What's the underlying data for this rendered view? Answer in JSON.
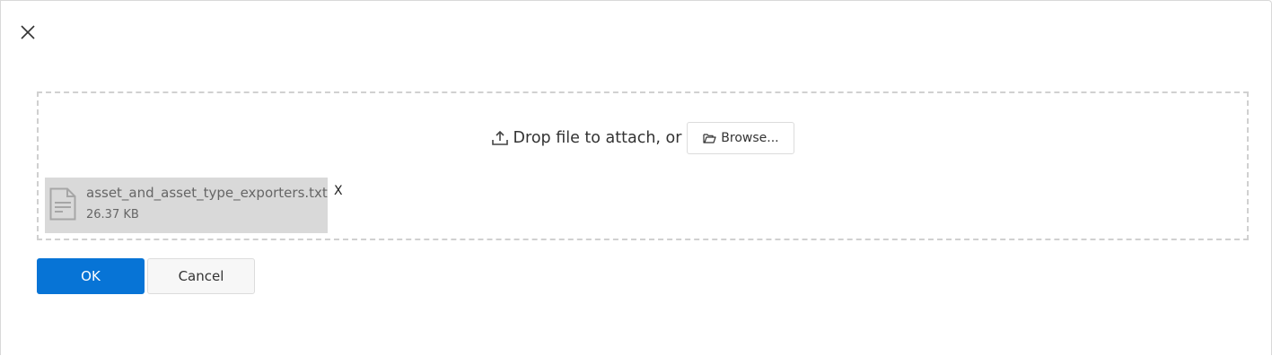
{
  "dialog": {
    "close_icon": "close-icon"
  },
  "dropzone": {
    "upload_icon": "upload-icon",
    "prompt": "Drop file to attach, or",
    "browse_icon": "folder-open-icon",
    "browse_label": "Browse..."
  },
  "attachment": {
    "file_icon": "document-icon",
    "name": "asset_and_asset_type_exporters.txt",
    "size": "26.37 KB",
    "remove_label": "X"
  },
  "actions": {
    "ok_label": "OK",
    "cancel_label": "Cancel"
  },
  "colors": {
    "primary": "#0774d6",
    "attachment_bg": "#d9d9d9",
    "dashed_border": "#d0d0d0"
  }
}
